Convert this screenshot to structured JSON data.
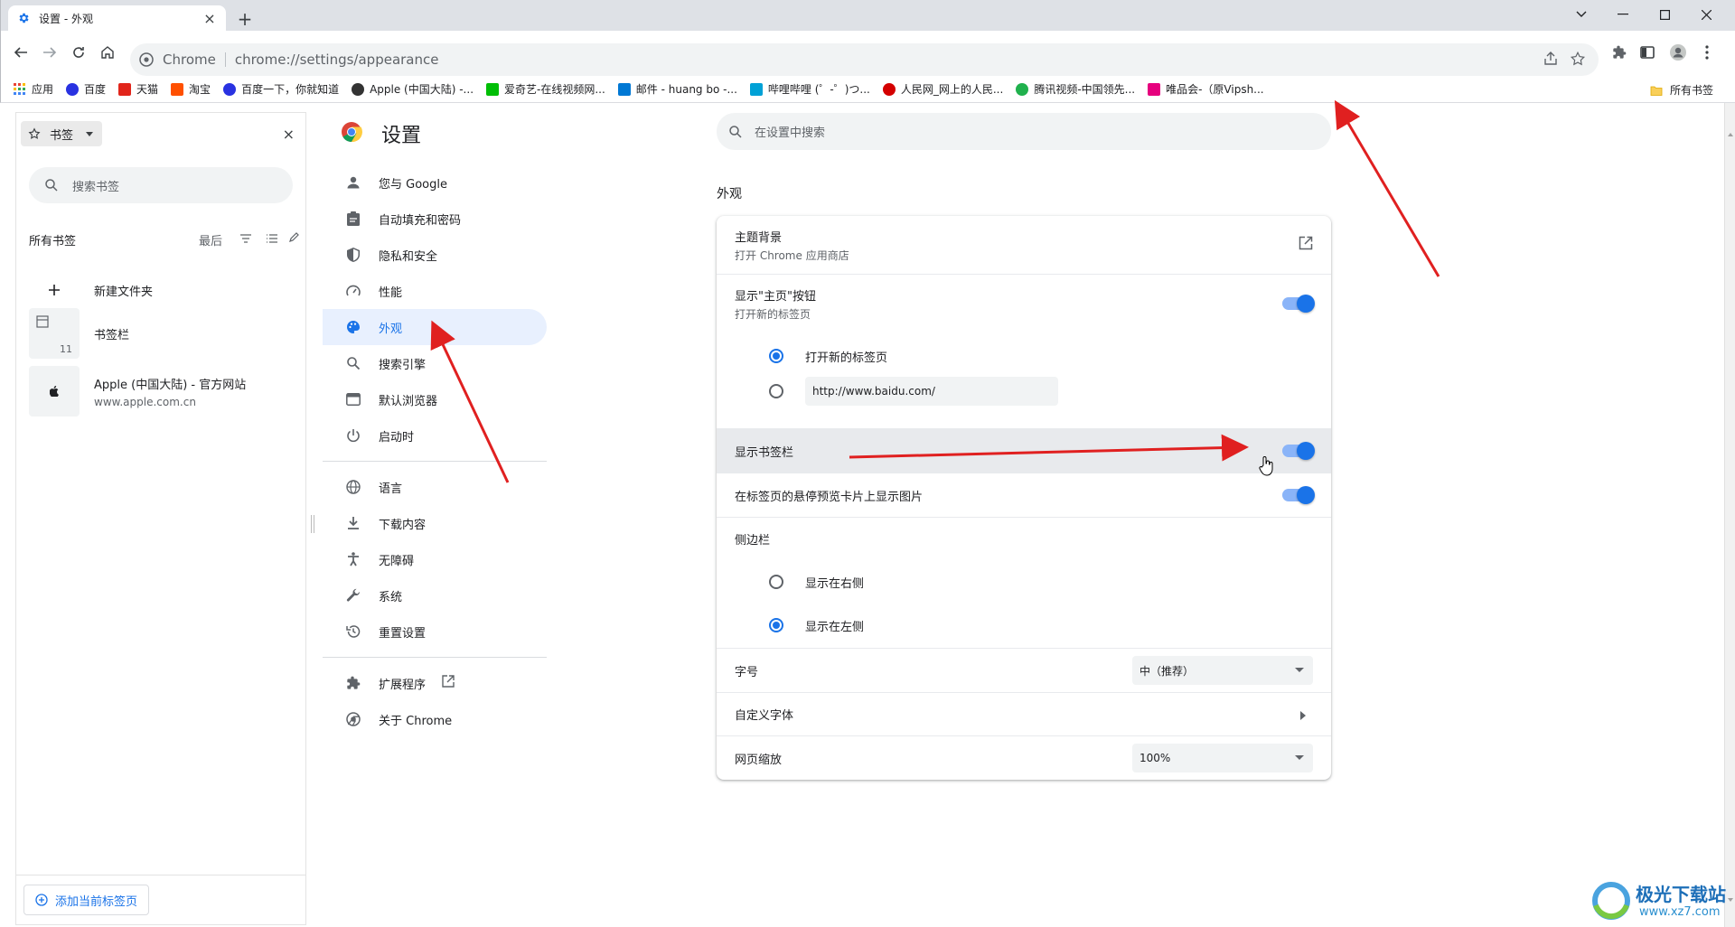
{
  "tab": {
    "title": "设置 - 外观",
    "close": "×",
    "new_tab": "+"
  },
  "window_controls": {
    "menu": "chevron-down-icon",
    "minimize": "minimize-icon",
    "maximize": "maximize-icon",
    "close": "close-icon"
  },
  "omnibox": {
    "chip": "Chrome",
    "url": "chrome://settings/appearance"
  },
  "bookmarks_bar": {
    "items": [
      {
        "label": "应用",
        "color": "#ea4335"
      },
      {
        "label": "百度",
        "color": "#2932e1"
      },
      {
        "label": "天猫",
        "color": "#e1251b"
      },
      {
        "label": "淘宝",
        "color": "#ff5000"
      },
      {
        "label": "百度一下，你就知道",
        "color": "#2932e1"
      },
      {
        "label": "Apple (中国大陆) -...",
        "color": "#333333"
      },
      {
        "label": "爱奇艺-在线视频网...",
        "color": "#00be06"
      },
      {
        "label": "邮件 - huang bo -...",
        "color": "#0078d4"
      },
      {
        "label": "哔哩哔哩 (゜-゜)つ...",
        "color": "#00a1d6"
      },
      {
        "label": "人民网_网上的人民...",
        "color": "#d40000"
      },
      {
        "label": "腾讯视频-中国领先...",
        "color": "#20b14d"
      },
      {
        "label": "唯品会-（原Vipsh...",
        "color": "#e6007e"
      }
    ],
    "all_bookmarks": "所有书签"
  },
  "side_panel": {
    "header": "书签",
    "close": "×",
    "search_placeholder": "搜索书签",
    "all_bookmarks": "所有书签",
    "sort": "最后",
    "items": [
      {
        "title": "新建文件夹",
        "sub": ""
      },
      {
        "title": "书签栏",
        "sub": "",
        "count": "11"
      },
      {
        "title": "Apple (中国大陆) - 官方网站",
        "sub": "www.apple.com.cn"
      }
    ],
    "add_button": "添加当前标签页"
  },
  "settings": {
    "title": "设置",
    "search_placeholder": "在设置中搜索",
    "nav": [
      {
        "label": "您与 Google",
        "icon": "person-icon"
      },
      {
        "label": "自动填充和密码",
        "icon": "clipboard-icon"
      },
      {
        "label": "隐私和安全",
        "icon": "shield-icon"
      },
      {
        "label": "性能",
        "icon": "speedometer-icon"
      },
      {
        "label": "外观",
        "icon": "palette-icon",
        "active": true
      },
      {
        "label": "搜索引擎",
        "icon": "search-icon"
      },
      {
        "label": "默认浏览器",
        "icon": "browser-icon"
      },
      {
        "label": "启动时",
        "icon": "power-icon"
      },
      {
        "label": "语言",
        "icon": "globe-icon"
      },
      {
        "label": "下载内容",
        "icon": "download-icon"
      },
      {
        "label": "无障碍",
        "icon": "accessibility-icon"
      },
      {
        "label": "系统",
        "icon": "wrench-icon"
      },
      {
        "label": "重置设置",
        "icon": "history-icon"
      },
      {
        "label": "扩展程序",
        "icon": "puzzle-icon"
      },
      {
        "label": "关于 Chrome",
        "icon": "chrome-icon"
      }
    ],
    "section_title": "外观",
    "rows": {
      "theme": {
        "label": "主题背景",
        "sub": "打开 Chrome 应用商店"
      },
      "home_button": {
        "label": "显示\"主页\"按钮",
        "sub": "打开新的标签页",
        "on": true
      },
      "home_opt_newtab": "打开新的标签页",
      "home_opt_url": "http://www.baidu.com/",
      "bookmarks_bar": {
        "label": "显示书签栏",
        "on": true
      },
      "hover_preview": {
        "label": "在标签页的悬停预览卡片上显示图片",
        "on": true
      },
      "side_panel": {
        "label": "侧边栏"
      },
      "side_right": "显示在右侧",
      "side_left": "显示在左侧",
      "font_size": {
        "label": "字号",
        "value": "中（推荐）"
      },
      "custom_fonts": {
        "label": "自定义字体"
      },
      "page_zoom": {
        "label": "网页缩放",
        "value": "100%"
      }
    }
  },
  "watermark": {
    "title": "极光下载站",
    "url": "www.xz7.com"
  },
  "colors": {
    "accent": "#1a73e8",
    "arrow": "#e02020"
  }
}
